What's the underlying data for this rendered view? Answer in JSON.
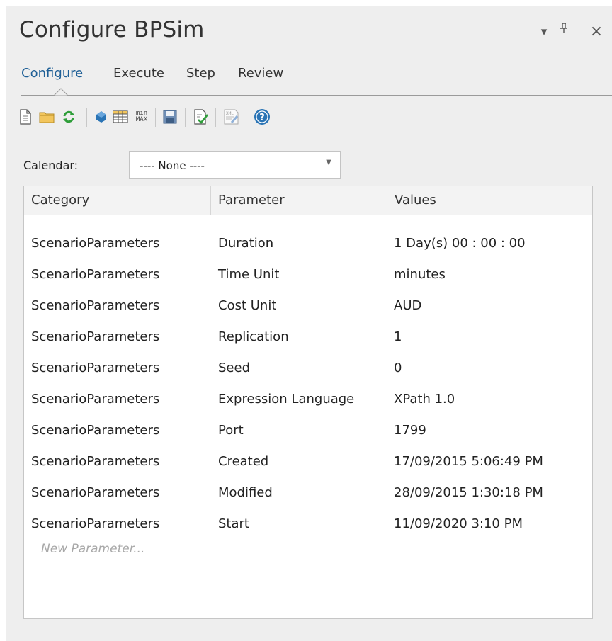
{
  "window": {
    "title": "Configure BPSim",
    "dropdown_glyph": "▾",
    "pin_glyph": "ᵖ",
    "close_glyph": "×"
  },
  "tabs": [
    {
      "label": "Configure",
      "active": true
    },
    {
      "label": "Execute",
      "active": false
    },
    {
      "label": "Step",
      "active": false
    },
    {
      "label": "Review",
      "active": false
    }
  ],
  "toolbar": {
    "icons": [
      "new-document-icon",
      "open-folder-icon",
      "refresh-icon",
      "shape-icon",
      "table-icon",
      "min-max-icon",
      "save-icon",
      "validate-icon",
      "xml-export-icon",
      "help-icon"
    ],
    "minmax_top": "min",
    "minmax_bottom": "MAX",
    "xml_text": "XML",
    "help_glyph": "?"
  },
  "calendar": {
    "label": "Calendar:",
    "value": "---- None ----"
  },
  "table": {
    "headers": [
      "Category",
      "Parameter",
      "Values"
    ],
    "rows": [
      [
        "ScenarioParameters",
        "Duration",
        "1 Day(s) 00 : 00 : 00"
      ],
      [
        "ScenarioParameters",
        "Time Unit",
        "minutes"
      ],
      [
        "ScenarioParameters",
        "Cost Unit",
        "AUD"
      ],
      [
        "ScenarioParameters",
        "Replication",
        "1"
      ],
      [
        "ScenarioParameters",
        "Seed",
        "0"
      ],
      [
        "ScenarioParameters",
        "Expression Language",
        "XPath 1.0"
      ],
      [
        "ScenarioParameters",
        "Port",
        "1799"
      ],
      [
        "ScenarioParameters",
        "Created",
        "17/09/2015 5:06:49 PM"
      ],
      [
        "ScenarioParameters",
        "Modified",
        "28/09/2015 1:30:18 PM"
      ],
      [
        "ScenarioParameters",
        "Start",
        "11/09/2020 3:10 PM"
      ]
    ],
    "new_row_placeholder": "New Parameter..."
  },
  "colors": {
    "panel_bg": "#eeeeee",
    "active_tab": "#1e5f96",
    "help_icon": "#2a74b5"
  }
}
